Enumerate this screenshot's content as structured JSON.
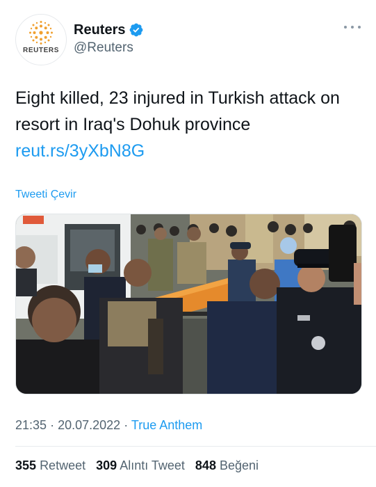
{
  "author": {
    "display_name": "Reuters",
    "handle": "@Reuters",
    "avatar_text": "REUTERS",
    "verified": true
  },
  "tweet": {
    "text": "Eight killed, 23 injured in Turkish attack on resort in Iraq's Dohuk province",
    "link": "reut.rs/3yXbN8G",
    "translate_label": "Tweeti Çevir"
  },
  "meta": {
    "time": "21:35",
    "separator": "·",
    "date": "20.07.2022",
    "app": "True Anthem"
  },
  "stats": {
    "retweets": "355",
    "retweets_label": "Retweet",
    "quotes": "309",
    "quotes_label": "Alıntı Tweet",
    "likes": "848",
    "likes_label": "Beğeni"
  },
  "icons": {
    "verified": "verified-badge-icon",
    "more": "more-options-icon"
  },
  "colors": {
    "link": "#1d9bf0",
    "secondary_text": "#536471",
    "primary_text": "#0f1419",
    "brand_orange": "#f0a030"
  }
}
